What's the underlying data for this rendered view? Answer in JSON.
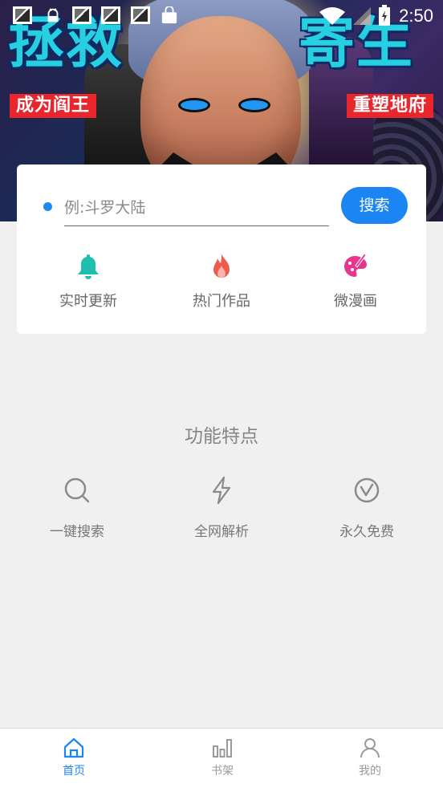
{
  "status_bar": {
    "time": "2:50",
    "notification_icons": [
      "image-notification-icon",
      "android-notification-icon",
      "image-notification-icon",
      "image-notification-icon",
      "image-notification-icon",
      "bag-notification-icon"
    ],
    "wifi_icon": "wifi-icon",
    "signal_icon": "signal-icon",
    "battery_icon": "battery-charging-icon"
  },
  "banner": {
    "title_left": "拯救",
    "title_right": "寄生",
    "tag_left": "成为阎王",
    "tag_right": "重塑地府"
  },
  "search": {
    "placeholder": "例:斗罗大陆",
    "value": "",
    "button_label": "搜索"
  },
  "quick_links": [
    {
      "label": "实时更新",
      "icon": "bell-icon",
      "color": "#1fbfb0"
    },
    {
      "label": "热门作品",
      "icon": "flame-icon",
      "color": "#ef5a4a"
    },
    {
      "label": "微漫画",
      "icon": "palette-icon",
      "color": "#e8368f"
    }
  ],
  "features": {
    "title": "功能特点",
    "items": [
      {
        "label": "一键搜索",
        "icon": "search-icon"
      },
      {
        "label": "全网解析",
        "icon": "lightning-icon"
      },
      {
        "label": "永久免费",
        "icon": "check-circle-icon"
      }
    ]
  },
  "bottom_nav": {
    "items": [
      {
        "label": "首页",
        "icon": "home-icon",
        "active": true
      },
      {
        "label": "书架",
        "icon": "bookshelf-icon",
        "active": false
      },
      {
        "label": "我的",
        "icon": "profile-icon",
        "active": false
      }
    ]
  },
  "colors": {
    "accent": "#1b86f3",
    "background": "#f0f0f0",
    "card": "#ffffff"
  }
}
